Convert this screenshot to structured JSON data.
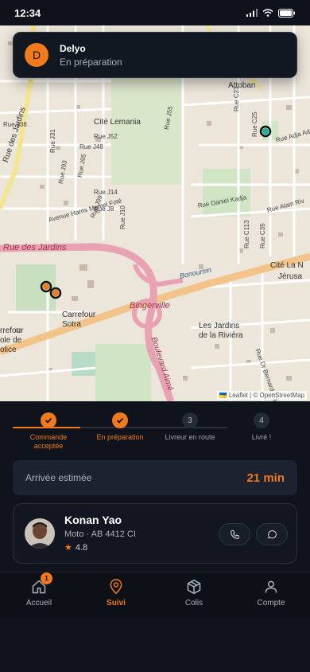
{
  "status_bar": {
    "time": "12:34"
  },
  "notification": {
    "initial": "D",
    "title": "Delyo",
    "subtitle": "En préparation"
  },
  "map": {
    "labels": {
      "attoban": "Attoban",
      "cite_lemania": "Cité Lemania",
      "rue_des_jardins_v": "Rue des Jardins",
      "rue_des_jardins_h": "Rue des Jardins",
      "avenue": "Avenue Harris Memel Foté",
      "rue_j52": "Rue J52",
      "rue_j48": "Rue J48",
      "rue_j14": "Rue J14",
      "rue_j8": "Rue J8",
      "rue_j10": "Rue J10",
      "rue_c23": "Rue C23",
      "rue_c25": "Rue C25",
      "rue_adja": "Rue Adja Ad",
      "rue_daniel": "Rue Daniel Kadja",
      "rue_alain": "Rue Alain Riv",
      "cite_la_n": "Cité La N",
      "jerusa": "Jérusa",
      "bonoumin": "Bonoumin",
      "bingerville": "Bingerville",
      "carrefour_sotra": "Carrefour\nSotra",
      "carrefour_ecole": "rrefour\nole de\nolice",
      "jardins_riviera": "Les Jardins\nde la Riviéra",
      "boulevard": "Boulevard Aimé",
      "rue_bernard": "Rue Dr Bernard Adjoffi",
      "rue_j38": "Rue J38",
      "rue_j31": "Rue J31",
      "rue_j93": "Rue J93",
      "rue_j95": "Rue J95",
      "rue_j99": "Rue J99",
      "rue_c113": "Rue C113",
      "rue_c35": "Rue C35",
      "rue_j55": "Rue J55"
    },
    "attribution": "🇺🇦 Leaflet | © OpenStreetMap",
    "colors": {
      "courier_marker": "#19b39b",
      "restaurant_marker": "#f07a1c",
      "main_road": "#e8a0b0",
      "secondary_road": "#f7d88a"
    }
  },
  "steps": [
    {
      "number": "1",
      "label": "Commande acceptée",
      "state": "done"
    },
    {
      "number": "2",
      "label": "En préparation",
      "state": "current"
    },
    {
      "number": "3",
      "label": "Livreur en route",
      "state": "todo"
    },
    {
      "number": "4",
      "label": "Livré !",
      "state": "todo"
    }
  ],
  "eta": {
    "label": "Arrivée estimée",
    "value": "21 min"
  },
  "driver": {
    "name": "Konan Yao",
    "vehicle": "Moto · AB 4412 CI",
    "rating": "4.8"
  },
  "tabs": [
    {
      "label": "Accueil",
      "icon": "home-icon",
      "badge": "1",
      "active": false
    },
    {
      "label": "Suivi",
      "icon": "location-pin-icon",
      "active": true
    },
    {
      "label": "Colis",
      "icon": "package-icon",
      "active": false
    },
    {
      "label": "Compte",
      "icon": "user-icon",
      "active": false
    }
  ],
  "colors": {
    "accent": "#f07a1c",
    "background": "#0f141c",
    "card": "#1c2230"
  }
}
